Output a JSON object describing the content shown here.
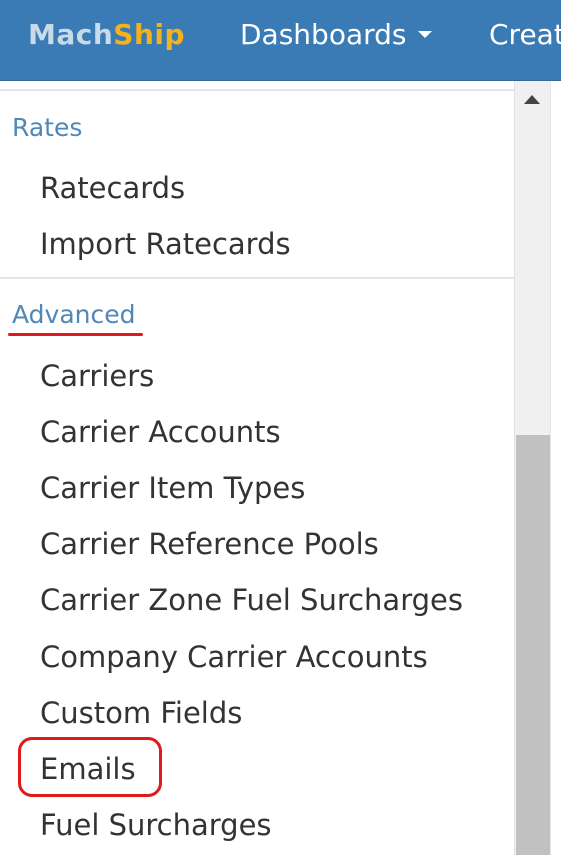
{
  "navbar": {
    "logo_part1": "Mach",
    "logo_part2": "Ship",
    "dashboards_label": "Dashboards",
    "create_label": "Creat",
    "brand_color": "#3a7bb5",
    "logo_accent_color": "#f5b21a"
  },
  "menu": {
    "rates_header": "Rates",
    "rates_items": [
      {
        "label": "Ratecards"
      },
      {
        "label": "Import Ratecards"
      }
    ],
    "advanced_header": "Advanced",
    "advanced_items": [
      {
        "label": "Carriers"
      },
      {
        "label": "Carrier Accounts"
      },
      {
        "label": "Carrier Item Types"
      },
      {
        "label": "Carrier Reference Pools"
      },
      {
        "label": "Carrier Zone Fuel Surcharges"
      },
      {
        "label": "Company Carrier Accounts"
      },
      {
        "label": "Custom Fields"
      },
      {
        "label": "Emails"
      },
      {
        "label": "Fuel Surcharges"
      }
    ],
    "header_color": "#4f87b7",
    "annotation_color": "#e01a1a"
  },
  "scrollbar": {
    "up_arrow_icon": "triangle-up-icon"
  }
}
